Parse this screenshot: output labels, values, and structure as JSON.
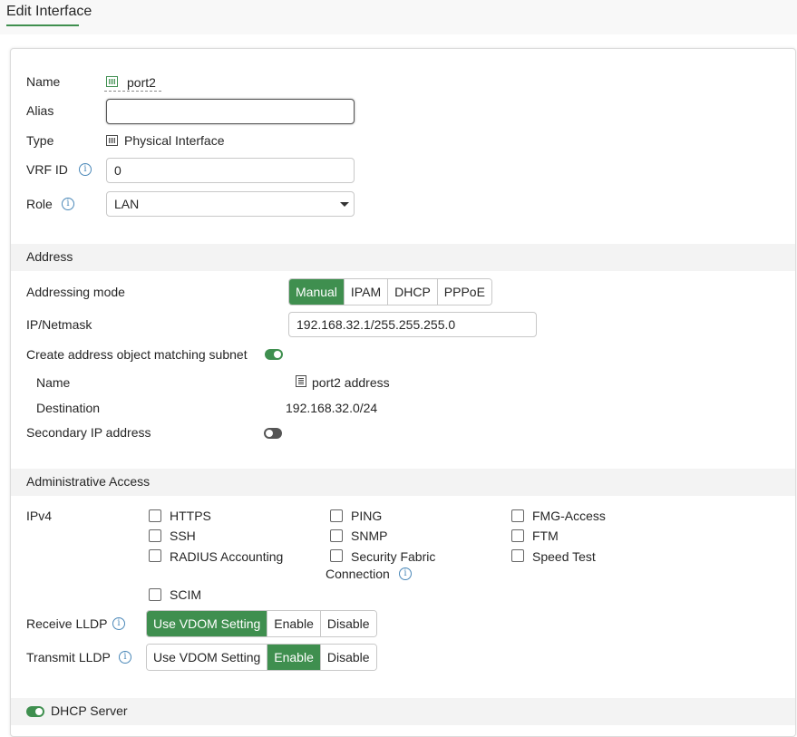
{
  "page": {
    "title": "Edit Interface"
  },
  "general": {
    "name_label": "Name",
    "name_value": "port2",
    "alias_label": "Alias",
    "alias_value": "",
    "type_label": "Type",
    "type_value": "Physical Interface",
    "vrf_label": "VRF ID",
    "vrf_value": "0",
    "role_label": "Role",
    "role_value": "LAN"
  },
  "address": {
    "section_title": "Address",
    "mode_label": "Addressing mode",
    "modes": [
      "Manual",
      "IPAM",
      "DHCP",
      "PPPoE"
    ],
    "mode_selected": "Manual",
    "ip_label": "IP/Netmask",
    "ip_value": "192.168.32.1/255.255.255.0",
    "create_obj_label": "Create address object matching subnet",
    "create_obj_enabled": true,
    "obj_name_label": "Name",
    "obj_name_value": "port2 address",
    "obj_dest_label": "Destination",
    "obj_dest_value": "192.168.32.0/24",
    "secondary_label": "Secondary IP address",
    "secondary_enabled": false
  },
  "admin": {
    "section_title": "Administrative Access",
    "ipv4_label": "IPv4",
    "col1": [
      "HTTPS",
      "SSH",
      "RADIUS Accounting"
    ],
    "col2": [
      "PING",
      "SNMP"
    ],
    "col2_fabric_line1": "Security Fabric",
    "col2_fabric_line2": "Connection",
    "col3": [
      "FMG-Access",
      "FTM",
      "Speed Test"
    ],
    "scim": "SCIM",
    "receive_lldp_label": "Receive LLDP",
    "transmit_lldp_label": "Transmit LLDP",
    "lldp_options": [
      "Use VDOM Setting",
      "Enable",
      "Disable"
    ],
    "receive_selected": "Use VDOM Setting",
    "transmit_selected": "Enable"
  },
  "dhcp": {
    "section_title": "DHCP Server",
    "enabled": true
  },
  "colors": {
    "accent": "#3f8f4f",
    "info": "#4b88b8",
    "section_bg": "#f3f3f3"
  },
  "icons": {
    "interface": "port-icon",
    "info": "info-icon",
    "address": "address-object-icon"
  }
}
